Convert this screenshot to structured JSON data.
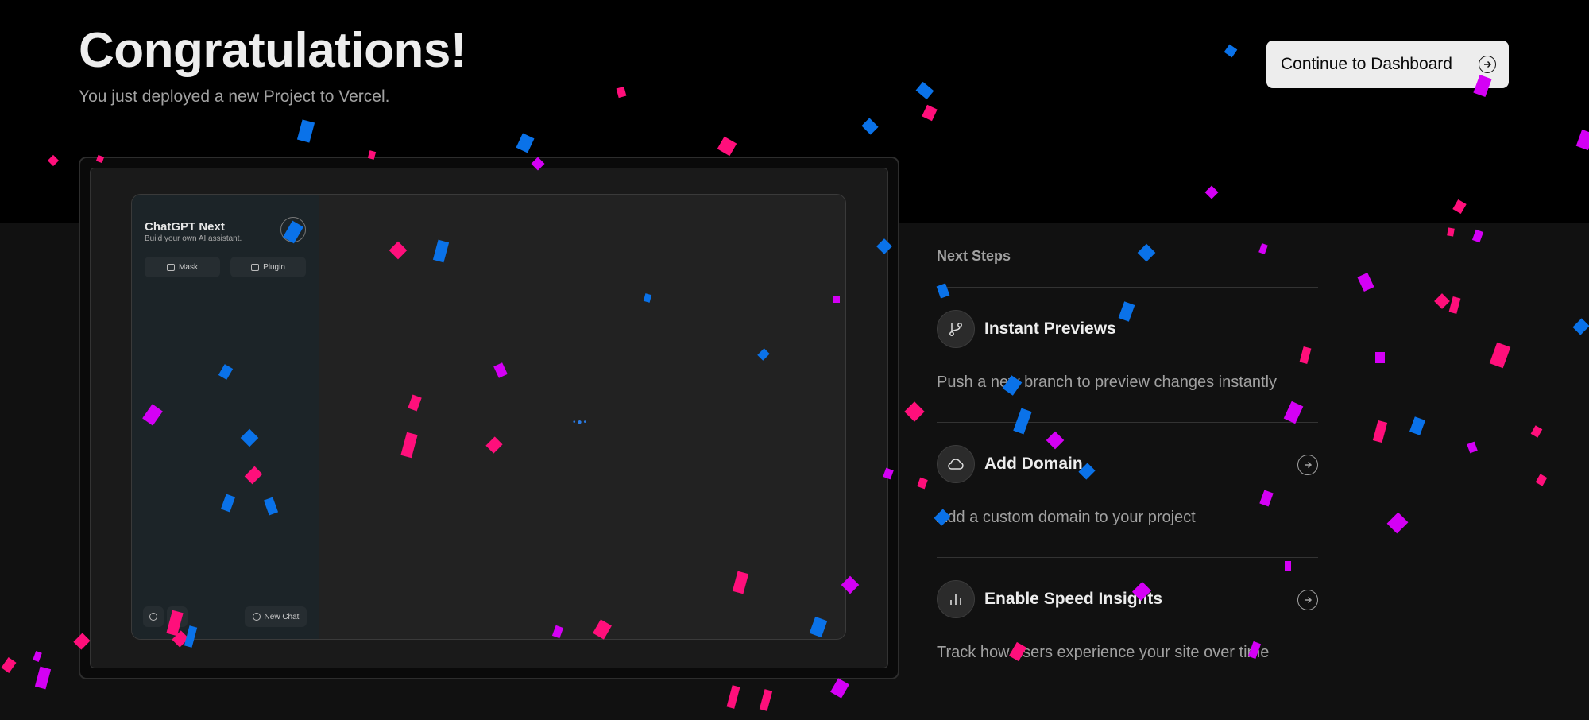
{
  "header": {
    "title": "Congratulations!",
    "subtitle": "You just deployed a new Project to Vercel.",
    "cta_label": "Continue to Dashboard"
  },
  "preview": {
    "app_name": "ChatGPT Next",
    "app_tagline": "Build your own AI assistant.",
    "mask_label": "Mask",
    "plugin_label": "Plugin",
    "new_chat_label": "New Chat"
  },
  "next_steps": {
    "heading": "Next Steps",
    "items": [
      {
        "title": "Instant Previews",
        "description": "Push a new branch to preview changes instantly",
        "icon": "git-branch-icon"
      },
      {
        "title": "Add Domain",
        "description": "Add a custom domain to your project",
        "icon": "cloud-icon"
      },
      {
        "title": "Enable Speed Insights",
        "description": "Track how users experience your site over time",
        "icon": "bar-chart-icon"
      }
    ]
  },
  "colors": {
    "confetti_blue": "#0a72e9",
    "confetti_pink": "#ff0f7b",
    "confetti_magenta": "#d400f5",
    "background_top": "#000000",
    "background_bottom": "#111111"
  }
}
